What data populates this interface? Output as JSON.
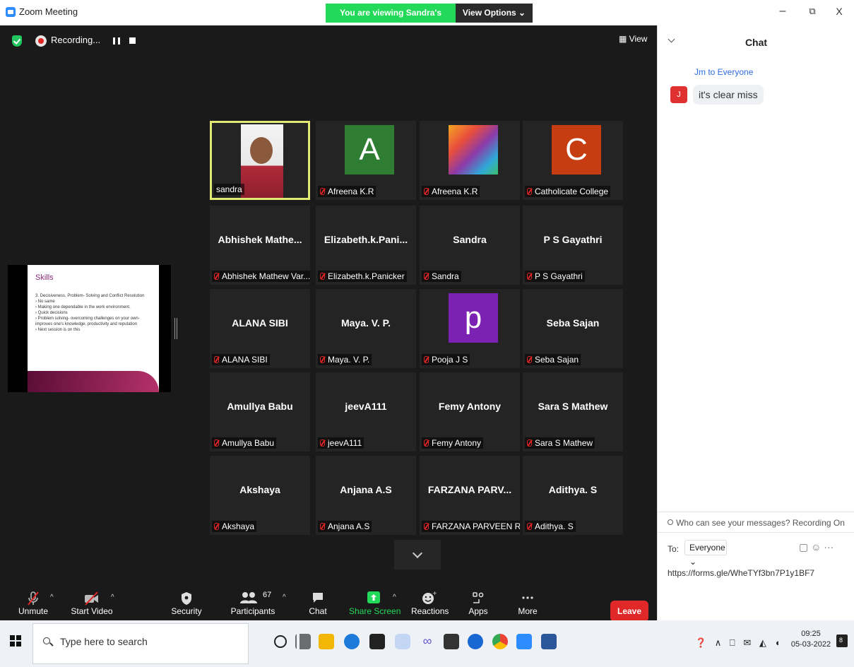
{
  "window": {
    "title": "Zoom Meeting",
    "banner": "You are viewing Sandra's screen",
    "view_options": "View Options ⌄",
    "minimize": "–",
    "restore": "⧉",
    "close": "X"
  },
  "meeting": {
    "recording_label": "Recording...",
    "view_label": "▦ View"
  },
  "shared_slide": {
    "title": "Skills",
    "body": "3. Decisiveness, Problem- Solving and Conflict Resolution\n› No same\n› Making one dependable in the work environment.\n› Quick decisions\n› Problem solving- overcoming challenges on your own- improves one's knowledge, productivity and reputation\n› Next session is on this"
  },
  "participants": [
    {
      "name": "",
      "label": "sandra",
      "avatar_letter": "",
      "avatar_color": "",
      "video": true,
      "active": true
    },
    {
      "name": "",
      "label": "Afreena K.R",
      "avatar_letter": "A",
      "avatar_color": "#2e7d32"
    },
    {
      "name": "",
      "label": "Afreena K.R",
      "avatar_letter": "",
      "avatar_color": "lion"
    },
    {
      "name": "",
      "label": "Catholicate College",
      "avatar_letter": "C",
      "avatar_color": "#c63d11"
    },
    {
      "name": "Abhishek  Mathe...",
      "label": "Abhishek Mathew Var..."
    },
    {
      "name": "Elizabeth.k.Pani...",
      "label": "Elizabeth.k.Panicker"
    },
    {
      "name": "Sandra",
      "label": "Sandra"
    },
    {
      "name": "P S Gayathri",
      "label": "P S Gayathri"
    },
    {
      "name": "ALANA SIBI",
      "label": "ALANA SIBI"
    },
    {
      "name": "Maya. V. P.",
      "label": "Maya. V. P."
    },
    {
      "name": "",
      "label": "Pooja J S",
      "avatar_letter": "p",
      "avatar_color": "#7b22b3"
    },
    {
      "name": "Seba Sajan",
      "label": "Seba Sajan"
    },
    {
      "name": "Amullya Babu",
      "label": "Amullya Babu"
    },
    {
      "name": "jeevA111",
      "label": "jeevA111"
    },
    {
      "name": "Femy Antony",
      "label": "Femy Antony"
    },
    {
      "name": "Sara S Mathew",
      "label": "Sara S Mathew"
    },
    {
      "name": "Akshaya",
      "label": "Akshaya"
    },
    {
      "name": "Anjana A.S",
      "label": "Anjana A.S"
    },
    {
      "name": "FARZANA PARV...",
      "label": "FARZANA PARVEEN R"
    },
    {
      "name": "Adithya. S",
      "label": "Adithya. S"
    }
  ],
  "toolbar": {
    "unmute": "Unmute",
    "start_video": "Start Video",
    "security": "Security",
    "participants": "Participants",
    "participants_count": "67",
    "chat": "Chat",
    "share_screen": "Share Screen",
    "reactions": "Reactions",
    "apps": "Apps",
    "more": "More",
    "leave": "Leave",
    "share_color": "#23d959"
  },
  "chat": {
    "title": "Chat",
    "messages": [
      {
        "sender_line": "Jm to Everyone",
        "avatar": "J",
        "text": "it's clear miss"
      }
    ],
    "notice": "Who can see your messages? Recording On",
    "to_label": "To:",
    "to_value": "Everyone ⌄",
    "tools": "▢ ☺ ···",
    "input_value": "https://forms.gle/WheTYf3bn7P1y1BF7"
  },
  "taskbar": {
    "search_placeholder": "Type here to search",
    "time": "09:25",
    "date": "05-03-2022",
    "tray_icons": "❓ ∧ ⎕ ✉ ◭ ◖",
    "notification_count": "8"
  }
}
